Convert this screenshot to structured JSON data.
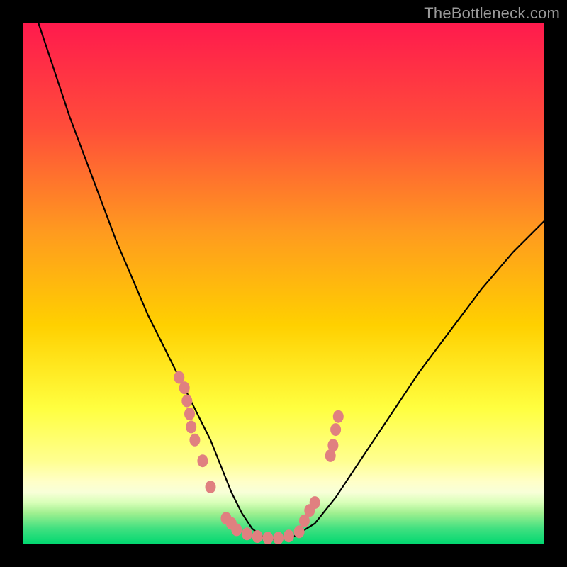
{
  "watermark": "TheBottleneck.com",
  "colors": {
    "frame_bg": "#000000",
    "gradient_top": "#ff1a4d",
    "gradient_mid_upper": "#ff7a1f",
    "gradient_mid": "#ffd000",
    "gradient_mid_lower": "#ffff40",
    "gradient_pale_band": "#ffffb8",
    "gradient_bottom": "#00e676",
    "curve": "#000000",
    "marker_fill": "#e08080",
    "marker_stroke": "#c45a5a"
  },
  "chart_data": {
    "type": "line",
    "title": "",
    "xlabel": "",
    "ylabel": "",
    "xlim": [
      0,
      100
    ],
    "ylim": [
      0,
      100
    ],
    "series": [
      {
        "name": "bottleneck-curve",
        "x": [
          3,
          6,
          9,
          12,
          15,
          18,
          21,
          24,
          27,
          30,
          32,
          34,
          36,
          38,
          40,
          42,
          44,
          46,
          48,
          52,
          56,
          60,
          64,
          70,
          76,
          82,
          88,
          94,
          100
        ],
        "y": [
          100,
          91,
          82,
          74,
          66,
          58,
          51,
          44,
          38,
          32,
          28,
          24,
          20,
          15,
          10,
          6,
          3,
          1.5,
          1,
          1.5,
          4,
          9,
          15,
          24,
          33,
          41,
          49,
          56,
          62
        ]
      }
    ],
    "markers": [
      {
        "name": "left-cluster",
        "x": [
          30,
          31,
          31.5,
          32,
          32.3,
          33,
          34.5,
          36,
          39,
          40
        ],
        "y": [
          32,
          30,
          27.5,
          25,
          22.5,
          20,
          16,
          11,
          5,
          4
        ]
      },
      {
        "name": "bottom-cluster",
        "x": [
          41,
          43,
          45,
          47,
          49,
          51,
          53
        ],
        "y": [
          2.8,
          2,
          1.5,
          1.2,
          1.2,
          1.6,
          2.4
        ]
      },
      {
        "name": "right-cluster",
        "x": [
          54,
          55,
          56,
          59,
          59.5,
          60,
          60.5
        ],
        "y": [
          4.5,
          6.5,
          8,
          17,
          19,
          22,
          24.5
        ]
      }
    ],
    "markers_note": "salmon dots along lower V; positions estimated from pixels"
  }
}
